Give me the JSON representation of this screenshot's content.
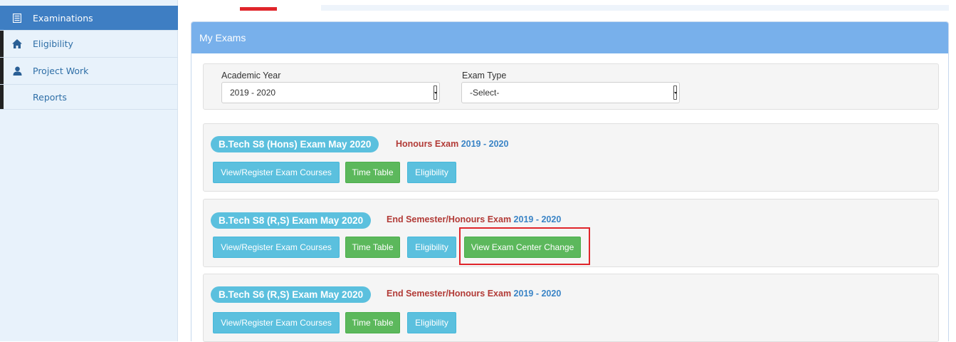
{
  "sidebar": {
    "items": [
      {
        "label": "Examinations",
        "icon": "list-icon"
      },
      {
        "label": "Eligibility",
        "icon": "home-icon"
      },
      {
        "label": "Project Work",
        "icon": "user-icon"
      },
      {
        "label": "Reports",
        "icon": ""
      }
    ]
  },
  "panel": {
    "title": "My Exams"
  },
  "filters": {
    "academic_year_label": "Academic Year",
    "academic_year_value": "2019 - 2020",
    "exam_type_label": "Exam Type",
    "exam_type_value": "-Select-"
  },
  "exams": [
    {
      "name": "B.Tech S8 (Hons) Exam May 2020",
      "type": "Honours Exam",
      "year": "2019 - 2020",
      "buttons": [
        "View/Register Exam Courses",
        "Time Table",
        "Eligibility"
      ]
    },
    {
      "name": "B.Tech S8 (R,S) Exam May 2020",
      "type": "End Semester/Honours Exam",
      "year": "2019 - 2020",
      "buttons": [
        "View/Register Exam Courses",
        "Time Table",
        "Eligibility",
        "View Exam Center Change"
      ]
    },
    {
      "name": "B.Tech S6 (R,S) Exam May 2020",
      "type": "End Semester/Honours Exam",
      "year": "2019 - 2020",
      "buttons": [
        "View/Register Exam Courses",
        "Time Table",
        "Eligibility"
      ]
    }
  ],
  "colors": {
    "sidebar_active": "#3e7ec3",
    "panel_header": "#78b0eb",
    "btn_info": "#5bc0de",
    "btn_success": "#5cb85c",
    "exam_type": "#b23b37",
    "exam_year": "#3a84c6",
    "highlight": "#e0252b"
  }
}
